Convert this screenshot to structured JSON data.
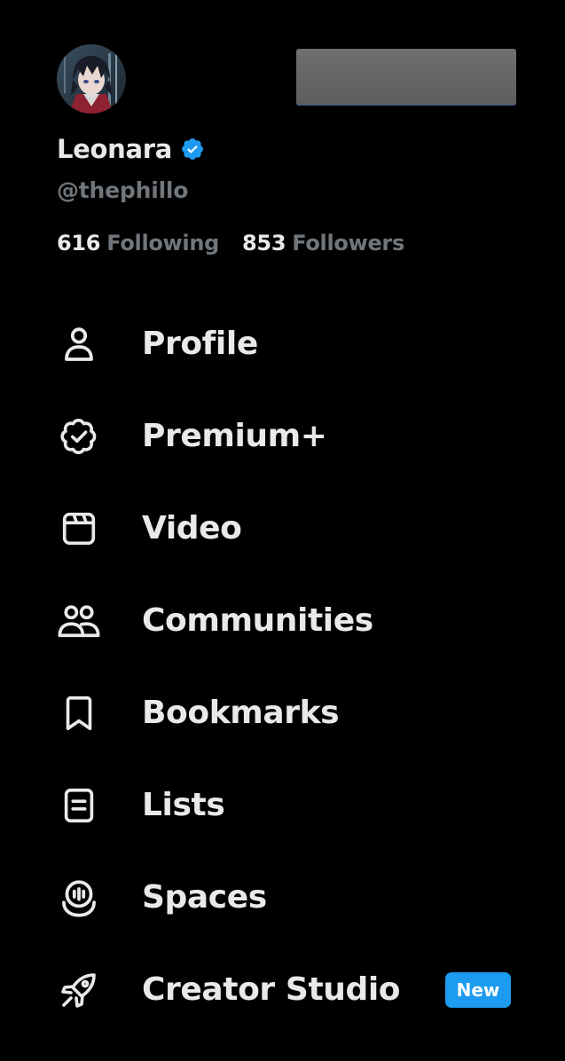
{
  "profile": {
    "display_name": "Leonara",
    "handle": "@thephillo",
    "following_count": "616",
    "following_label": "Following",
    "followers_count": "853",
    "followers_label": "Followers"
  },
  "menu": [
    {
      "label": "Profile",
      "icon": "person-icon"
    },
    {
      "label": "Premium+",
      "icon": "verified-badge-icon"
    },
    {
      "label": "Video",
      "icon": "video-icon"
    },
    {
      "label": "Communities",
      "icon": "communities-icon"
    },
    {
      "label": "Bookmarks",
      "icon": "bookmark-icon"
    },
    {
      "label": "Lists",
      "icon": "list-icon"
    },
    {
      "label": "Spaces",
      "icon": "spaces-icon"
    },
    {
      "label": "Creator Studio",
      "icon": "rocket-icon",
      "badge": "New"
    }
  ],
  "colors": {
    "background": "#000000",
    "primary_text": "#e7e9ea",
    "secondary_text": "#71767b",
    "accent": "#1d9bf0"
  }
}
